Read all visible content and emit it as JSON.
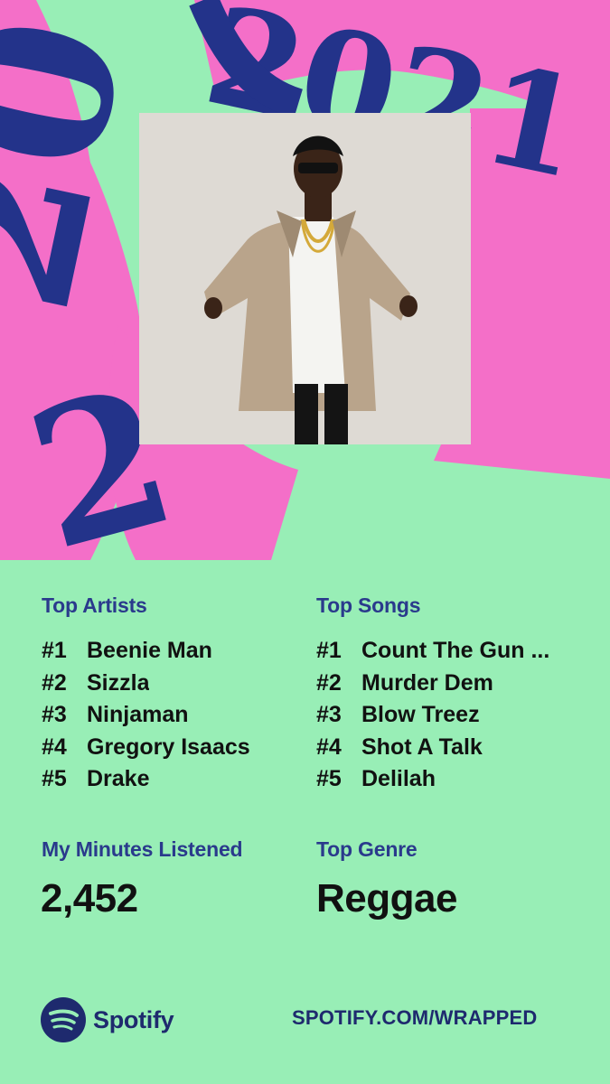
{
  "brand": {
    "name": "Spotify",
    "icon": "spotify-logo-icon"
  },
  "year_graphic": "2021",
  "artist_photo": {
    "subject": "top-artist-photo"
  },
  "top_artists": {
    "label": "Top Artists",
    "items": [
      {
        "rank": "#1",
        "name": "Beenie Man"
      },
      {
        "rank": "#2",
        "name": "Sizzla"
      },
      {
        "rank": "#3",
        "name": "Ninjaman"
      },
      {
        "rank": "#4",
        "name": "Gregory Isaacs"
      },
      {
        "rank": "#5",
        "name": "Drake"
      }
    ]
  },
  "top_songs": {
    "label": "Top Songs",
    "items": [
      {
        "rank": "#1",
        "name": "Count The Gun ..."
      },
      {
        "rank": "#2",
        "name": "Murder Dem"
      },
      {
        "rank": "#3",
        "name": "Blow Treez"
      },
      {
        "rank": "#4",
        "name": "Shot A Talk"
      },
      {
        "rank": "#5",
        "name": "Delilah"
      }
    ]
  },
  "minutes": {
    "label": "My Minutes Listened",
    "value": "2,452"
  },
  "genre": {
    "label": "Top Genre",
    "value": "Reggae"
  },
  "footer_link": "SPOTIFY.COM/WRAPPED",
  "colors": {
    "background": "#98EEB6",
    "pink": "#F46FC8",
    "navy": "#2A3A8C",
    "text": "#111111"
  }
}
